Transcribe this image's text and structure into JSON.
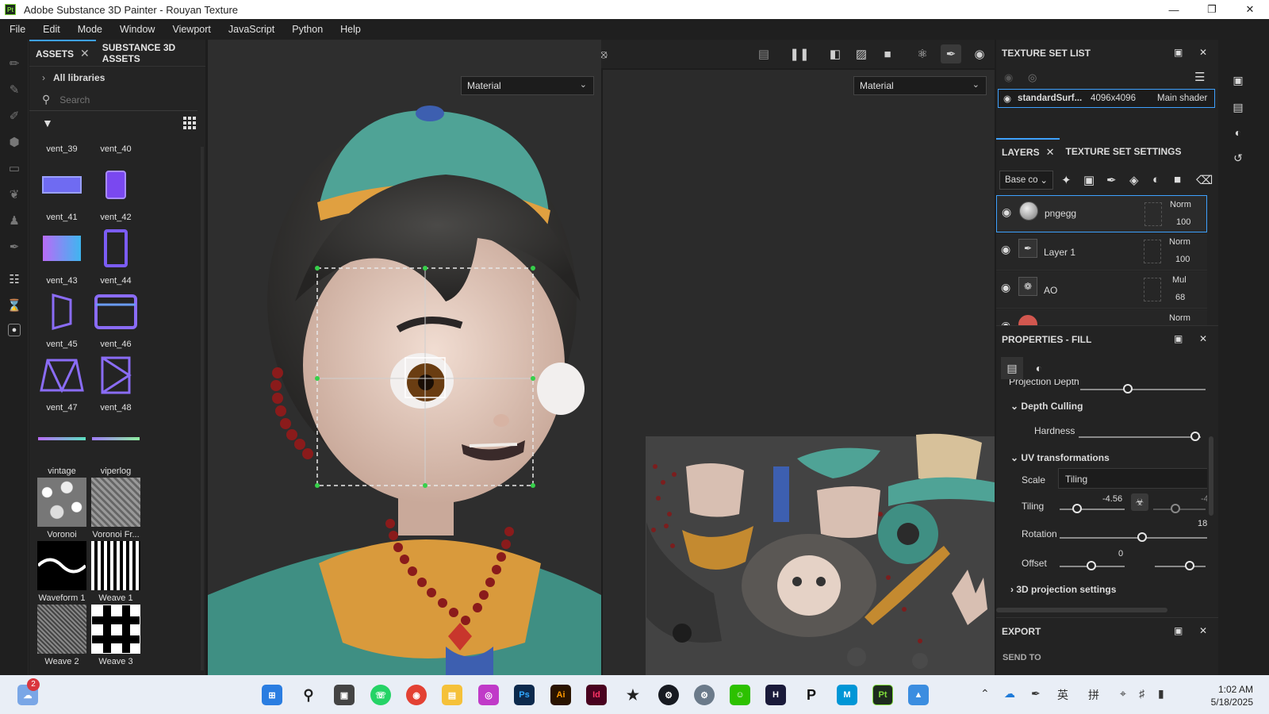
{
  "window": {
    "title": "Adobe Substance 3D Painter - Rouyan Texture",
    "app_icon": "Pt"
  },
  "menu": [
    "File",
    "Edit",
    "Mode",
    "Window",
    "Viewport",
    "JavaScript",
    "Python",
    "Help"
  ],
  "assets_panel": {
    "tab_assets": "ASSETS",
    "tab_substance": "SUBSTANCE 3D ASSETS",
    "libraries": "All libraries",
    "search_placeholder": "Search",
    "items": [
      {
        "label": "vent_39"
      },
      {
        "label": "vent_40"
      },
      {
        "label": "vent_41"
      },
      {
        "label": "vent_42"
      },
      {
        "label": "vent_43"
      },
      {
        "label": "vent_44"
      },
      {
        "label": "vent_45"
      },
      {
        "label": "vent_46"
      },
      {
        "label": "vent_47"
      },
      {
        "label": "vent_48"
      },
      {
        "label": "vintage"
      },
      {
        "label": "viperlog"
      },
      {
        "label": "Voronoi"
      },
      {
        "label": "Voronoi Fr..."
      },
      {
        "label": "Waveform 1"
      },
      {
        "label": "Weave 1"
      },
      {
        "label": "Weave 2"
      },
      {
        "label": "Weave 3"
      }
    ]
  },
  "viewport": {
    "material_left": "Material",
    "material_right": "Material"
  },
  "texture_set_list": {
    "title": "TEXTURE SET LIST",
    "set_name": "standardSurf...",
    "resolution": "4096x4096",
    "shader": "Main shader"
  },
  "layers": {
    "tab_layers": "LAYERS",
    "tab_settings": "TEXTURE SET SETTINGS",
    "channel": "Base co",
    "items": [
      {
        "name": "pngegg",
        "blend": "Norm",
        "opacity": "100"
      },
      {
        "name": "Layer 1",
        "blend": "Norm",
        "opacity": "100"
      },
      {
        "name": "AO",
        "blend": "Mul",
        "opacity": "68"
      },
      {
        "name": "",
        "blend": "Norm",
        "opacity": ""
      }
    ]
  },
  "properties": {
    "title": "PROPERTIES - FILL",
    "projection_depth_label": "Projection Depth",
    "depth_culling": "Depth Culling",
    "hardness_label": "Hardness",
    "uv_transformations": "UV transformations",
    "scale_label": "Scale",
    "scale_value": "Tiling",
    "tiling_label": "Tiling",
    "tiling_value": "-4.56",
    "tiling_value_2": "-4",
    "rotation_label": "Rotation",
    "rotation_value": "18",
    "offset_label": "Offset",
    "offset_value": "0",
    "projection_settings": "3D projection settings"
  },
  "export": {
    "title": "EXPORT",
    "send_to": "SEND TO"
  },
  "taskbar": {
    "notification_count": "2",
    "clock_time": "1:02 AM",
    "clock_date": "5/18/2025",
    "ime_1": "英",
    "ime_2": "拼"
  },
  "colors": {
    "accent": "#3ea1ff",
    "panel": "#232323",
    "viewport": "#2e2e2e"
  }
}
